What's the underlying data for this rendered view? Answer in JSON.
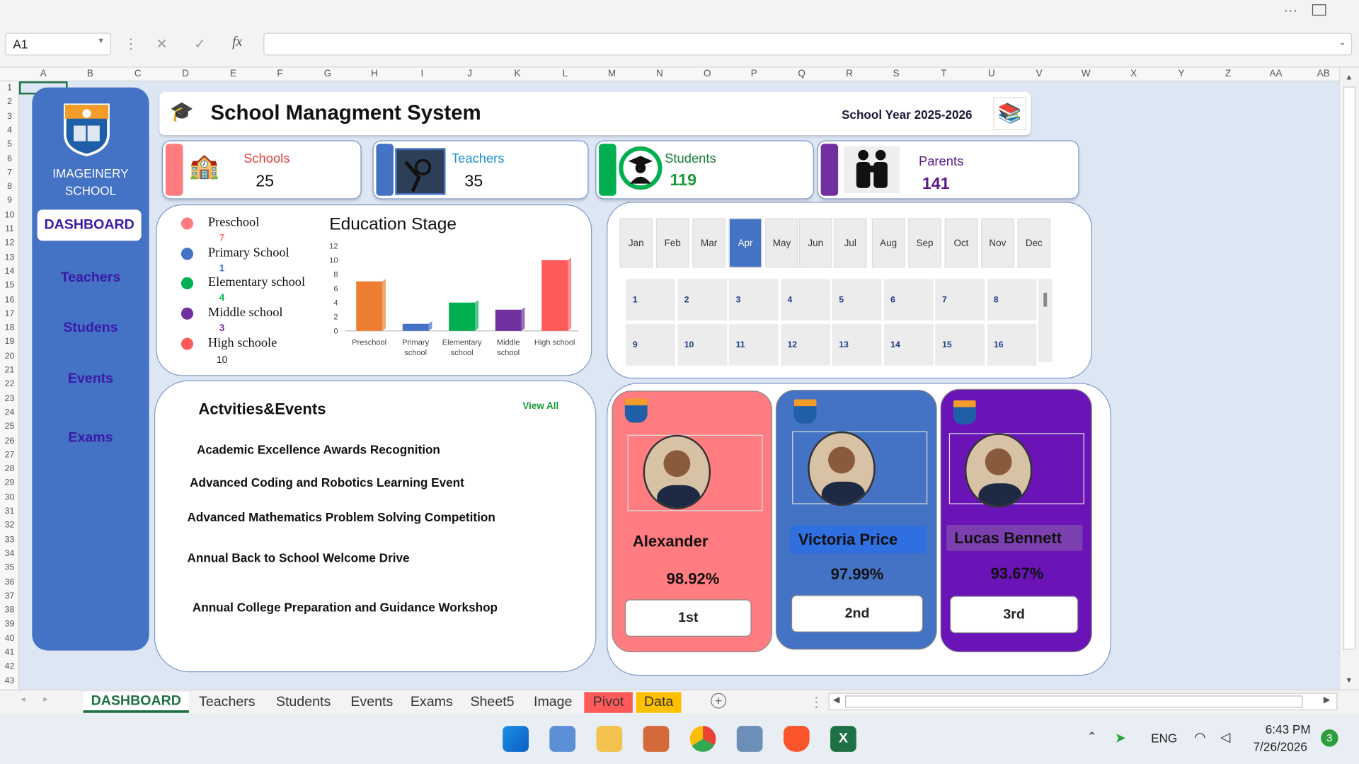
{
  "formula_bar": {
    "name_box": "A1",
    "fx": "fx",
    "cancel": "✕",
    "enter": "✓"
  },
  "columns": [
    "A",
    "B",
    "C",
    "D",
    "E",
    "F",
    "G",
    "H",
    "I",
    "J",
    "K",
    "L",
    "M",
    "N",
    "O",
    "P",
    "Q",
    "R",
    "S",
    "T",
    "U",
    "V",
    "W",
    "X",
    "Y",
    "Z",
    "AA",
    "AB"
  ],
  "rows": [
    "1",
    "2",
    "3",
    "4",
    "5",
    "6",
    "7",
    "8",
    "9",
    "10",
    "11",
    "12",
    "13",
    "14",
    "15",
    "16",
    "17",
    "18",
    "19",
    "20",
    "21",
    "22",
    "23",
    "24",
    "25",
    "26",
    "27",
    "28",
    "29",
    "30",
    "31",
    "32",
    "33",
    "34",
    "35",
    "36",
    "37",
    "38",
    "39",
    "40",
    "41",
    "42",
    "43"
  ],
  "sidebar": {
    "school_line1": "IMAGEINERY",
    "school_line2": "SCHOOL",
    "dashboard": "DASHBOARD",
    "items": [
      "Teachers",
      "Studens",
      "Events",
      "Exams"
    ]
  },
  "header": {
    "title": "School Managment System",
    "school_year": "School Year 2025-2026"
  },
  "stats": [
    {
      "label": "Schools",
      "value": "25",
      "color": "#ff7c80"
    },
    {
      "label": "Teachers",
      "value": "35",
      "color": "#4472c4"
    },
    {
      "label": "Students",
      "value": "119",
      "color": "#00b050"
    },
    {
      "label": "Parents",
      "value": "141",
      "color": "#7030a0"
    }
  ],
  "education": {
    "title": "Education Stage",
    "legend": [
      {
        "label": "Preschool",
        "value": "7",
        "color": "#ff7c80"
      },
      {
        "label": "Primary School",
        "value": "1",
        "color": "#4472c4"
      },
      {
        "label": "Elementary school",
        "value": "4",
        "color": "#00b050"
      },
      {
        "label": "Middle school",
        "value": "3",
        "color": "#7030a0"
      },
      {
        "label": "High schoole",
        "value": "10",
        "color": "#ff5a5a"
      }
    ]
  },
  "chart_data": {
    "type": "bar",
    "categories": [
      "Preschool",
      "Primary school",
      "Elementary school",
      "Middle school",
      "High school"
    ],
    "values": [
      7,
      1,
      4,
      3,
      10
    ],
    "colors": [
      "#ed7d31",
      "#4472c4",
      "#00b050",
      "#7030a0",
      "#ff5a5a"
    ],
    "yticks": [
      "0",
      "2",
      "4",
      "6",
      "8",
      "10",
      "12"
    ],
    "ylim": [
      0,
      12
    ],
    "title": "",
    "xlabel": "",
    "ylabel": ""
  },
  "calendar": {
    "months": [
      "Jan",
      "Feb",
      "Mar",
      "Apr",
      "May",
      "Jun",
      "Jul",
      "Aug",
      "Sep",
      "Oct",
      "Nov",
      "Dec"
    ],
    "selected": "Apr",
    "days": [
      "1",
      "2",
      "3",
      "4",
      "5",
      "6",
      "7",
      "8",
      "9",
      "10",
      "11",
      "12",
      "13",
      "14",
      "15",
      "16"
    ]
  },
  "events": {
    "title": "Actvities&Events",
    "view_all": "View All",
    "items": [
      "Academic Excellence Awards Recognition",
      "Advanced Coding and Robotics Learning Event",
      "Advanced Mathematics Problem Solving Competition",
      "Annual Back to School Welcome Drive",
      "Annual College Preparation and Guidance Workshop"
    ]
  },
  "top_students": [
    {
      "name": "Alexander",
      "percent": "98.92%",
      "rank": "1st",
      "color": "#ff7c80"
    },
    {
      "name": "Victoria Price",
      "percent": "97.99%",
      "rank": "2nd",
      "color": "#4472c4"
    },
    {
      "name": "Lucas Bennett",
      "percent": "93.67%",
      "rank": "3rd",
      "color": "#7030a0"
    }
  ],
  "tabs": [
    "DASHBOARD",
    "Teachers",
    "Students",
    "Events",
    "Exams",
    "Sheet5",
    "Image",
    "Pivot",
    "Data"
  ],
  "taskbar": {
    "lang": "ENG",
    "time": "6:43 PM",
    "date": "7/26/2026",
    "notif": "3"
  }
}
